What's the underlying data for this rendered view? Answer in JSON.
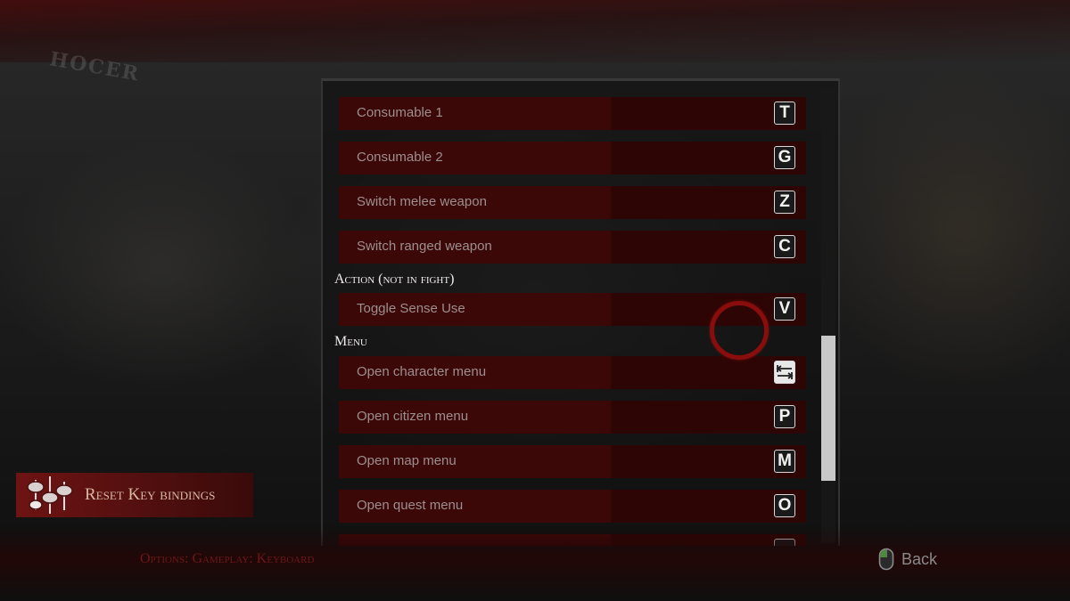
{
  "background": {
    "sign_text": "HOCER"
  },
  "bindings": [
    {
      "section": "",
      "label": "Consumable 1",
      "key": "T"
    },
    {
      "section": "",
      "label": "Consumable 2",
      "key": "G"
    },
    {
      "section": "",
      "label": "Switch melee weapon",
      "key": "Z"
    },
    {
      "section": "",
      "label": "Switch ranged weapon",
      "key": "C"
    }
  ],
  "sections": {
    "action": {
      "title": "Action (not in fight)",
      "items": [
        {
          "label": "Toggle Sense Use",
          "key": "V"
        }
      ]
    },
    "menu": {
      "title": "Menu",
      "items": [
        {
          "label": "Open character menu",
          "key_icon": "tab-icon"
        },
        {
          "label": "Open citizen menu",
          "key": "P"
        },
        {
          "label": "Open map menu",
          "key": "M"
        },
        {
          "label": "Open quest menu",
          "key": "O"
        },
        {
          "label": "",
          "key": ""
        }
      ]
    }
  },
  "scrollbar": {
    "position_fraction": 0.62
  },
  "reset_button": {
    "label": "Reset Key bindings",
    "icon": "sliders-icon"
  },
  "footer": {
    "breadcrumb": "Options: Gameplay: Keyboard",
    "back_label": "Back",
    "back_icon": "mouse-icon"
  },
  "colors": {
    "row_bg": "#3c0707",
    "accent": "#8a0d0d",
    "reset_bg": "#6e1313"
  }
}
